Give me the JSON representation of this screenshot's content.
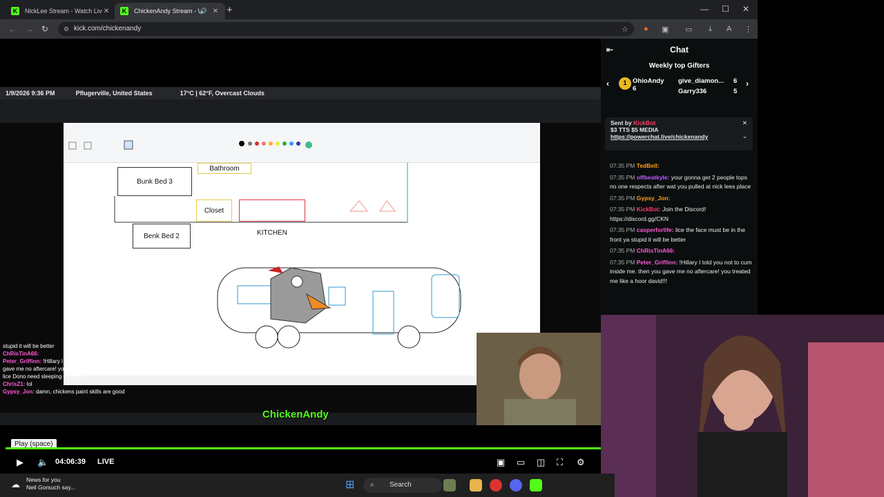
{
  "browser": {
    "tabs": [
      {
        "title": "NickLee Stream - Watch Live on",
        "active": false
      },
      {
        "title": "ChickenAndy Stream - Wat",
        "active": true
      }
    ],
    "url": "kick.com/chickenandy"
  },
  "stream_overlay": {
    "datetime": "1/9/2026 9:36 PM",
    "location": "Pflugerville, United States",
    "weather": "17°C | 62°F, Overcast Clouds",
    "brand": "ChickenAndy",
    "rooms": {
      "bathroom": "Bathroom",
      "bunk3": "Bunk Bed 3",
      "closet": "Closet",
      "kitchen": "KITCHEN",
      "bunk2": "Benk Bed 2"
    },
    "chat_lines": [
      {
        "user": "",
        "text": "stupid it will be better"
      },
      {
        "user": "ChRisTinA66:",
        "text": ""
      },
      {
        "user": "Peter_Griffinn:",
        "text": "!Hillary I told you not to cum inside me. then you gave me no aftercare! you treated me like a hoor david!!!"
      },
      {
        "user": "",
        "text": "lice Dono need sleeping quarters"
      },
      {
        "user": "ChrisZ1:",
        "text": "lol"
      },
      {
        "user": "Gypsy_Jon:",
        "text": "damn, chickens paint skills are good"
      }
    ]
  },
  "player": {
    "tooltip": "Play (space)",
    "time": "04:06:39",
    "live_label": "LIVE"
  },
  "chat": {
    "title": "Chat",
    "top_gifters_label": "Weekly top Gifters",
    "gifters": [
      {
        "rank": "1",
        "name": "OhioAndy",
        "count": "6"
      },
      {
        "name": "give_diamon...",
        "count": "6"
      },
      {
        "name": "Garry336",
        "count": "5"
      }
    ],
    "pinned": {
      "sent_by": "Sent by",
      "sender": "KickBot",
      "amount": "$3 TTS $5 MEDIA",
      "link": "https://powerchat.live/chickenandy"
    },
    "messages": [
      {
        "ts": "07:35 PM",
        "user": "TedBell:",
        "text": "",
        "color": "#ff9f1a"
      },
      {
        "ts": "07:35 PM",
        "user": "offbeatkyle:",
        "text": "your gonna get 2 people tops no one respects after wat you pulled at nick lees place",
        "color": "#c05cff"
      },
      {
        "ts": "07:35 PM",
        "user": "Gypsy_Jon:",
        "text": "",
        "color": "#ff9f1a"
      },
      {
        "ts": "07:35 PM",
        "user": "KickBot:",
        "text": "Join the Discord! https://discord.gg/CKN",
        "color": "#ff3b6b"
      },
      {
        "ts": "07:35 PM",
        "user": "casperforlife:",
        "text": "lice the face must be in the front ya stupid it will be better",
        "color": "#ff5ad6"
      },
      {
        "ts": "07:35 PM",
        "user": "ChRisTinA66:",
        "text": "",
        "color": "#ff5ad6"
      },
      {
        "ts": "07:35 PM",
        "user": "Peter_Griffinn:",
        "text": "!Hillary I told you not to cum inside me. then you gave me no aftercare! you treated me like a hoor david!!!",
        "color": "#ff5ad6"
      }
    ]
  },
  "taskbar": {
    "news_title": "News for you",
    "news_sub": "Neil Gorsuch say...",
    "search": "Search"
  },
  "colors": {
    "kick_green": "#53fc18",
    "chat_bg": "#0b0e0f"
  }
}
